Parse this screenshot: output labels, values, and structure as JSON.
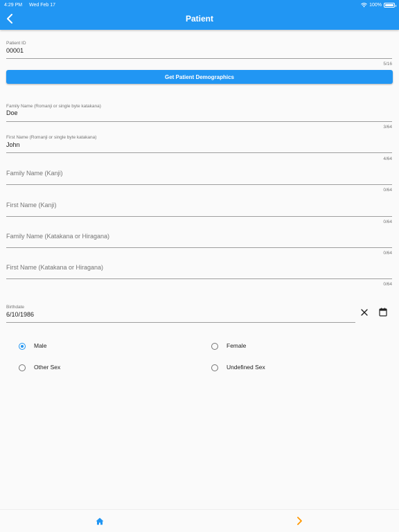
{
  "status_bar": {
    "time": "4:29 PM",
    "date": "Wed Feb 17",
    "battery": "100%"
  },
  "app_bar": {
    "title": "Patient",
    "back_icon": "chevron-left-icon"
  },
  "patient_id": {
    "label": "Patient ID",
    "value": "00001",
    "counter": "5/16"
  },
  "demographics_button": {
    "label": "Get Patient Demographics"
  },
  "family_name_romanji": {
    "label": "Family Name (Romanji or single byte katakana)",
    "value": "Doe",
    "counter": "3/64"
  },
  "first_name_romanji": {
    "label": "First Name (Romanji or single byte katakana)",
    "value": "John",
    "counter": "4/64"
  },
  "family_name_kanji": {
    "placeholder": "Family Name (Kanji)",
    "counter": "0/64"
  },
  "first_name_kanji": {
    "placeholder": "First Name (Kanji)",
    "counter": "0/64"
  },
  "family_name_kana": {
    "placeholder": "Family Name (Katakana or Hiragana)",
    "counter": "0/64"
  },
  "first_name_kana": {
    "placeholder": "First Name (Katakana or Hiragana)",
    "counter": "0/64"
  },
  "birthdate": {
    "label": "Birthdate",
    "value": "6/10/1986",
    "clear_icon": "close-icon",
    "calendar_icon": "calendar-icon"
  },
  "sex": {
    "selected": "Male",
    "options": [
      "Male",
      "Female",
      "Other Sex",
      "Undefined Sex"
    ]
  },
  "bottom_bar": {
    "home_icon": "home-icon",
    "next_icon": "chevron-right-icon"
  },
  "colors": {
    "primary": "#2196f3",
    "accent": "#ff9800",
    "text": "#212121",
    "hint": "#757575"
  }
}
